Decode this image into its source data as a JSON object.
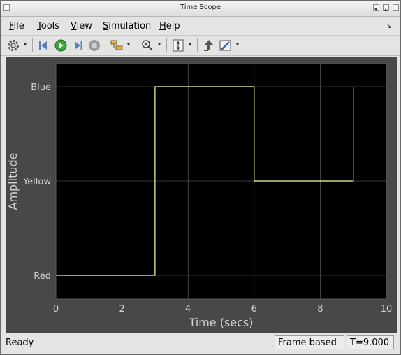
{
  "window": {
    "title": "Time Scope"
  },
  "menu": {
    "file": {
      "hotkey": "F",
      "rest": "ile"
    },
    "tools": {
      "hotkey": "T",
      "rest": "ools"
    },
    "view": {
      "hotkey": "V",
      "rest": "iew"
    },
    "simulation": {
      "hotkey": "S",
      "rest": "imulation"
    },
    "help": {
      "hotkey": "H",
      "rest": "elp"
    }
  },
  "toolbar": {
    "icons": [
      "settings-icon",
      "step-back-icon",
      "run-icon",
      "step-forward-icon",
      "stop-icon",
      "signal-selector-icon",
      "zoom-in-icon",
      "scale-axes-icon",
      "pan-icon",
      "style-icon"
    ]
  },
  "chart_data": {
    "type": "line",
    "xlabel": "Time (secs)",
    "ylabel": "Amplitude",
    "xlim": [
      0,
      10
    ],
    "x_ticks": [
      "0",
      "2",
      "4",
      "6",
      "8",
      "10"
    ],
    "y_categories": [
      "Red",
      "Yellow",
      "Blue"
    ],
    "grid": true,
    "colors": {
      "line": "#ffff9e",
      "axes_bg": "#000000",
      "figure_bg": "#484848",
      "grid": "#9a9a9a",
      "tick_text": "#d2d2d2"
    },
    "series": [
      {
        "x": [
          0,
          3,
          3,
          6,
          6,
          9,
          9
        ],
        "y": [
          "Red",
          "Red",
          "Blue",
          "Blue",
          "Yellow",
          "Yellow",
          "Blue"
        ]
      }
    ]
  },
  "status": {
    "ready": "Ready",
    "mode": "Frame based",
    "time": "T=9.000"
  }
}
